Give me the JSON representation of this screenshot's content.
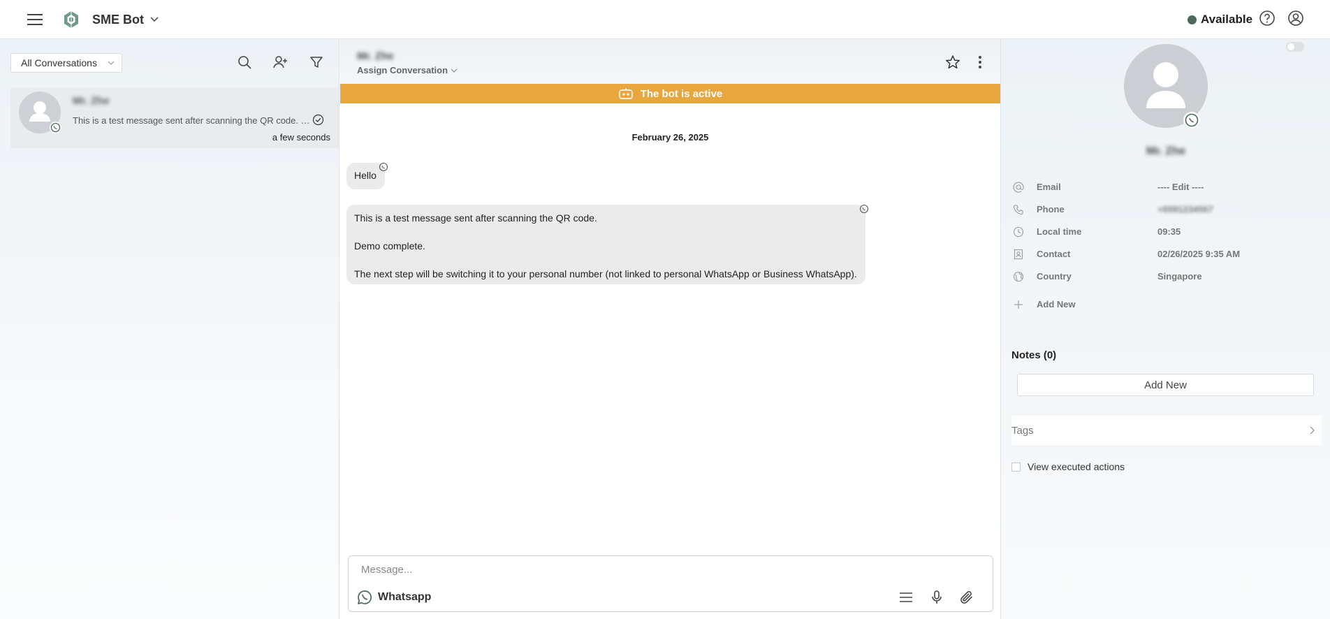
{
  "header": {
    "app_name": "SME Bot",
    "status_label": "Available",
    "status_color": "#4b6a5c"
  },
  "sidebar": {
    "filter_value": "All Conversations",
    "icons": [
      "search-icon",
      "add-user-icon",
      "filter-icon"
    ],
    "conversations": [
      {
        "name": "Mr. Zhe",
        "preview": "This is a test message sent after scanning the QR code. Demo complete.",
        "time": "a few seconds"
      }
    ]
  },
  "chat": {
    "contact_name": "Mr. Zhe",
    "assign_label": "Assign Conversation",
    "bot_banner": "The bot is active",
    "banner_color": "#e8a73e",
    "date": "February 26, 2025",
    "messages": [
      {
        "lines": [
          "Hello"
        ]
      },
      {
        "lines": [
          "This is a test message sent after scanning the QR code.",
          "Demo complete.",
          "The next step will be switching it to your personal number (not linked to personal WhatsApp or Business WhatsApp)."
        ]
      }
    ],
    "composer": {
      "placeholder": "Message...",
      "channel": "Whatsapp"
    }
  },
  "contact_panel": {
    "name": "Mr. Zhe",
    "fields": [
      {
        "icon": "at-icon",
        "label": "Email",
        "value": "---- Edit ----"
      },
      {
        "icon": "phone-icon",
        "label": "Phone",
        "value": "+6591234567"
      },
      {
        "icon": "clock-icon",
        "label": "Local time",
        "value": "09:35"
      },
      {
        "icon": "contact-card-icon",
        "label": "Contact",
        "value": "02/26/2025 9:35 AM"
      },
      {
        "icon": "globe-icon",
        "label": "Country",
        "value": "Singapore"
      }
    ],
    "add_new_field": "Add New",
    "notes_title": "Notes (0)",
    "add_note": "Add New",
    "tags_label": "Tags",
    "view_actions": "View executed actions"
  }
}
